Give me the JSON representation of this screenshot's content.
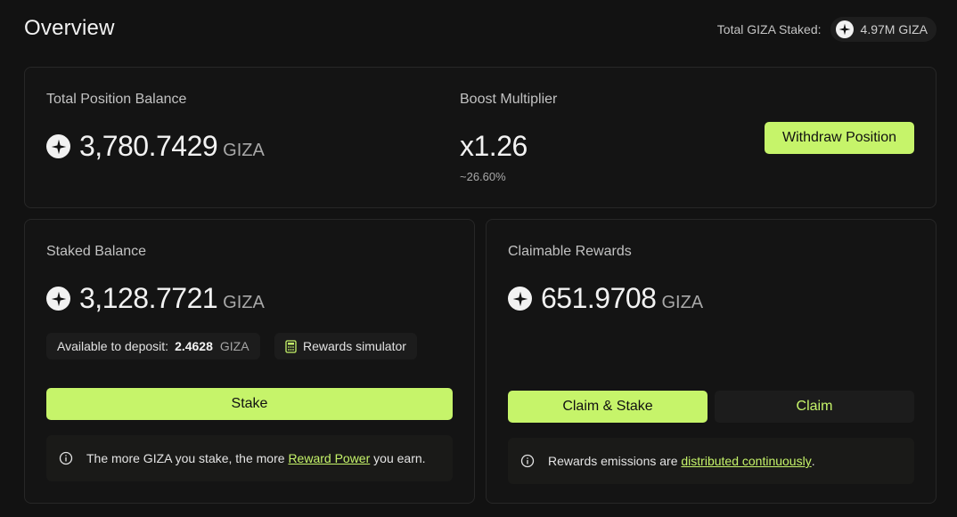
{
  "header": {
    "title": "Overview",
    "total_staked_label": "Total GIZA Staked:",
    "total_staked_value": "4.97M GIZA"
  },
  "position": {
    "balance_label": "Total Position Balance",
    "balance_value": "3,780.7429",
    "balance_unit": "GIZA",
    "boost_label": "Boost Multiplier",
    "boost_value": "x1.26",
    "boost_sub": "~26.60%",
    "withdraw_label": "Withdraw Position"
  },
  "staked": {
    "label": "Staked Balance",
    "value": "3,128.7721",
    "unit": "GIZA",
    "available_label": "Available to deposit:",
    "available_value": "2.4628",
    "available_unit": "GIZA",
    "simulator_label": "Rewards simulator",
    "stake_label": "Stake",
    "note_pre": "The more GIZA you stake, the more ",
    "note_link": "Reward Power",
    "note_post": " you earn."
  },
  "rewards": {
    "label": "Claimable Rewards",
    "value": "651.9708",
    "unit": "GIZA",
    "claim_stake_label": "Claim & Stake",
    "claim_label": "Claim",
    "note_pre": "Rewards emissions are ",
    "note_link": "distributed continuously",
    "note_post": "."
  },
  "colors": {
    "accent": "#c6f46a",
    "background": "#121212",
    "card": "#141414"
  },
  "icons": [
    "giza-coin-icon",
    "calculator-icon",
    "info-icon"
  ]
}
